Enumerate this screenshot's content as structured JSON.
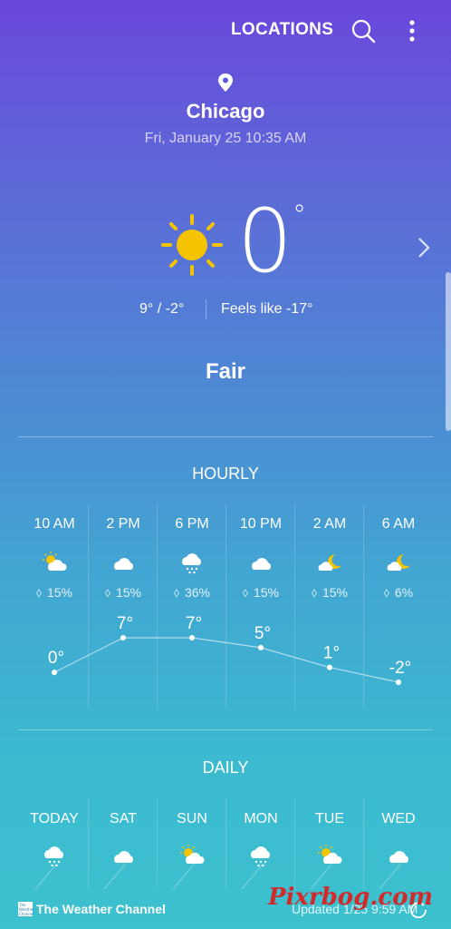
{
  "topbar": {
    "locations_label": "LOCATIONS"
  },
  "location": {
    "city": "Chicago",
    "datetime": "Fri, January 25 10:35 AM"
  },
  "current": {
    "temp": "0",
    "degree": "°",
    "hilo": "9°  /  -2°",
    "feels_like": "Feels like -17°",
    "condition": "Fair"
  },
  "hourly": {
    "title": "HOURLY",
    "items": [
      {
        "time": "10 AM",
        "icon": "partly-sunny-icon",
        "precip": "15%",
        "temp": "0°",
        "value": 0
      },
      {
        "time": "2 PM",
        "icon": "cloudy-icon",
        "precip": "15%",
        "temp": "7°",
        "value": 7
      },
      {
        "time": "6 PM",
        "icon": "snow-icon",
        "precip": "36%",
        "temp": "7°",
        "value": 7
      },
      {
        "time": "10 PM",
        "icon": "cloudy-icon",
        "precip": "15%",
        "temp": "5°",
        "value": 5
      },
      {
        "time": "2 AM",
        "icon": "partly-cloudy-night-icon",
        "precip": "15%",
        "temp": "1°",
        "value": 1
      },
      {
        "time": "6 AM",
        "icon": "partly-cloudy-night-icon",
        "precip": "6%",
        "temp": "-2°",
        "value": -2
      }
    ]
  },
  "daily": {
    "title": "DAILY",
    "items": [
      {
        "day": "TODAY",
        "icon": "snow-icon"
      },
      {
        "day": "SAT",
        "icon": "cloudy-icon"
      },
      {
        "day": "SUN",
        "icon": "partly-sunny-icon"
      },
      {
        "day": "MON",
        "icon": "snow-icon"
      },
      {
        "day": "TUE",
        "icon": "partly-sunny-icon"
      },
      {
        "day": "WED",
        "icon": "cloudy-icon"
      }
    ]
  },
  "footer": {
    "provider": "The Weather Channel",
    "logo_text": "The Weather Channel",
    "updated": "Updated  1/25  9:59 AM"
  },
  "watermark": "Pixrbog.com",
  "colors": {
    "sun": "#f5c400",
    "bg_top": "#6a47dc",
    "bg_bottom": "#3cc1cf"
  }
}
